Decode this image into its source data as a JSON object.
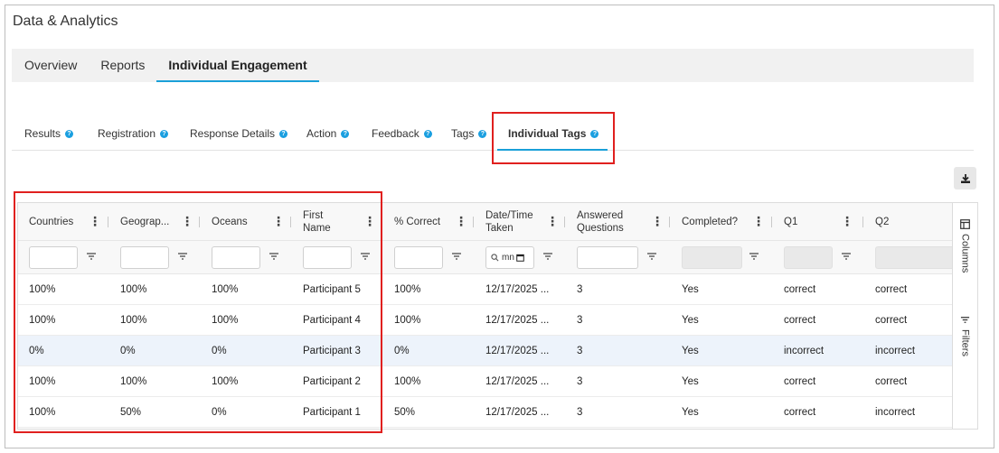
{
  "page": {
    "title": "Data & Analytics"
  },
  "top_tabs": [
    {
      "label": "Overview",
      "active": false
    },
    {
      "label": "Reports",
      "active": false
    },
    {
      "label": "Individual Engagement",
      "active": true
    }
  ],
  "sub_tabs": [
    {
      "label": "Results",
      "active": false
    },
    {
      "label": "Registration",
      "active": false
    },
    {
      "label": "Response Details",
      "active": false
    },
    {
      "label": "Action",
      "active": false
    },
    {
      "label": "Feedback",
      "active": false
    },
    {
      "label": "Tags",
      "active": false
    },
    {
      "label": "Individual Tags",
      "active": true
    }
  ],
  "help_icon_glyph": "?",
  "toolbar": {
    "download_icon": "download-icon"
  },
  "grid": {
    "columns": [
      {
        "header": "Countries"
      },
      {
        "header": "Geograp..."
      },
      {
        "header": "Oceans"
      },
      {
        "header": "First Name"
      },
      {
        "header": "% Correct"
      },
      {
        "header": "Date/Time Taken"
      },
      {
        "header": "Answered Questions"
      },
      {
        "header": "Completed?"
      },
      {
        "header": "Q1"
      },
      {
        "header": "Q2"
      }
    ],
    "date_filter_placeholder": "mn",
    "rows": [
      [
        "100%",
        "100%",
        "100%",
        "Participant 5",
        "100%",
        "12/17/2025 ...",
        "3",
        "Yes",
        "correct",
        "correct"
      ],
      [
        "100%",
        "100%",
        "100%",
        "Participant 4",
        "100%",
        "12/17/2025 ...",
        "3",
        "Yes",
        "correct",
        "correct"
      ],
      [
        "0%",
        "0%",
        "0%",
        "Participant 3",
        "0%",
        "12/17/2025 ...",
        "3",
        "Yes",
        "incorrect",
        "incorrect"
      ],
      [
        "100%",
        "100%",
        "100%",
        "Participant 2",
        "100%",
        "12/17/2025 ...",
        "3",
        "Yes",
        "correct",
        "correct"
      ],
      [
        "100%",
        "50%",
        "0%",
        "Participant 1",
        "50%",
        "12/17/2025 ...",
        "3",
        "Yes",
        "correct",
        "incorrect"
      ]
    ],
    "selected_row": 2
  },
  "side_panel": {
    "columns_label": "Columns",
    "filters_label": "Filters"
  },
  "colors": {
    "accent": "#1aa0d8",
    "highlight": "#e0201f",
    "selected_row": "#edf3fb"
  }
}
